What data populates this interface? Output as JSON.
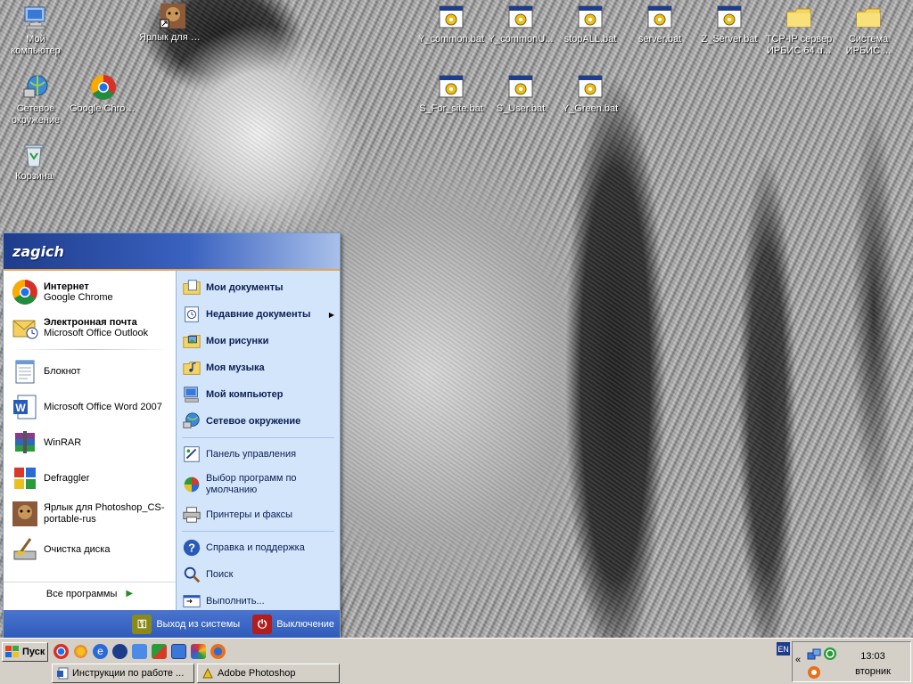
{
  "desktop": {
    "icons": [
      {
        "label": "Мой компьютер",
        "icon": "my-computer-icon"
      },
      {
        "label": "Ярлык для Photoshop_...",
        "icon": "photoshop-shortcut-icon"
      },
      {
        "label": "Y_common.bat",
        "icon": "bat-file-icon"
      },
      {
        "label": "Y_commonU...",
        "icon": "bat-file-icon"
      },
      {
        "label": "stopALL.bat",
        "icon": "bat-file-icon"
      },
      {
        "label": "server.bat",
        "icon": "bat-file-icon"
      },
      {
        "label": "Z_Server.bat",
        "icon": "bat-file-icon"
      },
      {
        "label": "TCP-IP сервер ИРБИС 64.u...",
        "icon": "folder-icon"
      },
      {
        "label": "Система ИРБИС ...",
        "icon": "folder-icon"
      },
      {
        "label": "Сетевое окружение",
        "icon": "network-icon"
      },
      {
        "label": "Google Chrome",
        "icon": "chrome-icon"
      },
      {
        "label": "S_For_site.bat",
        "icon": "bat-file-icon"
      },
      {
        "label": "S_User.bat",
        "icon": "bat-file-icon"
      },
      {
        "label": "Y_Green.bat",
        "icon": "bat-file-icon"
      },
      {
        "label": "Корзина",
        "icon": "recycle-bin-icon"
      }
    ]
  },
  "start_menu": {
    "user": "zagich",
    "pinned": [
      {
        "title": "Интернет",
        "subtitle": "Google Chrome"
      },
      {
        "title": "Электронная почта",
        "subtitle": "Microsoft Office Outlook"
      }
    ],
    "recent": [
      "Блокнот",
      "Microsoft Office Word 2007",
      "WinRAR",
      "Defraggler",
      "Ярлык для Photoshop_CS-portable-rus",
      "Очистка диска"
    ],
    "all_programs": "Все программы",
    "places": [
      "Мои документы",
      "Недавние документы",
      "Мои рисунки",
      "Моя музыка",
      "Мой компьютер",
      "Сетевое окружение"
    ],
    "system": [
      "Панель управления",
      "Выбор программ по умолчанию",
      "Принтеры и факсы"
    ],
    "help": [
      "Справка и поддержка",
      "Поиск",
      "Выполнить..."
    ],
    "logoff": "Выход из системы",
    "shutdown": "Выключение"
  },
  "taskbar": {
    "start_label": "Пуск",
    "tasks": [
      "Инструкции по работе ...",
      "Adobe Photoshop"
    ],
    "lang": "EN",
    "tray_expand": "«",
    "clock_time": "13:03",
    "clock_day": "вторник"
  },
  "colors": {
    "start_header": "#1e3c8c",
    "start_right_pane": "#d3e5fa",
    "taskbar": "#d4d0c8",
    "shutdown_red": "#b01e1e",
    "logoff_olive": "#8a8a1a"
  }
}
